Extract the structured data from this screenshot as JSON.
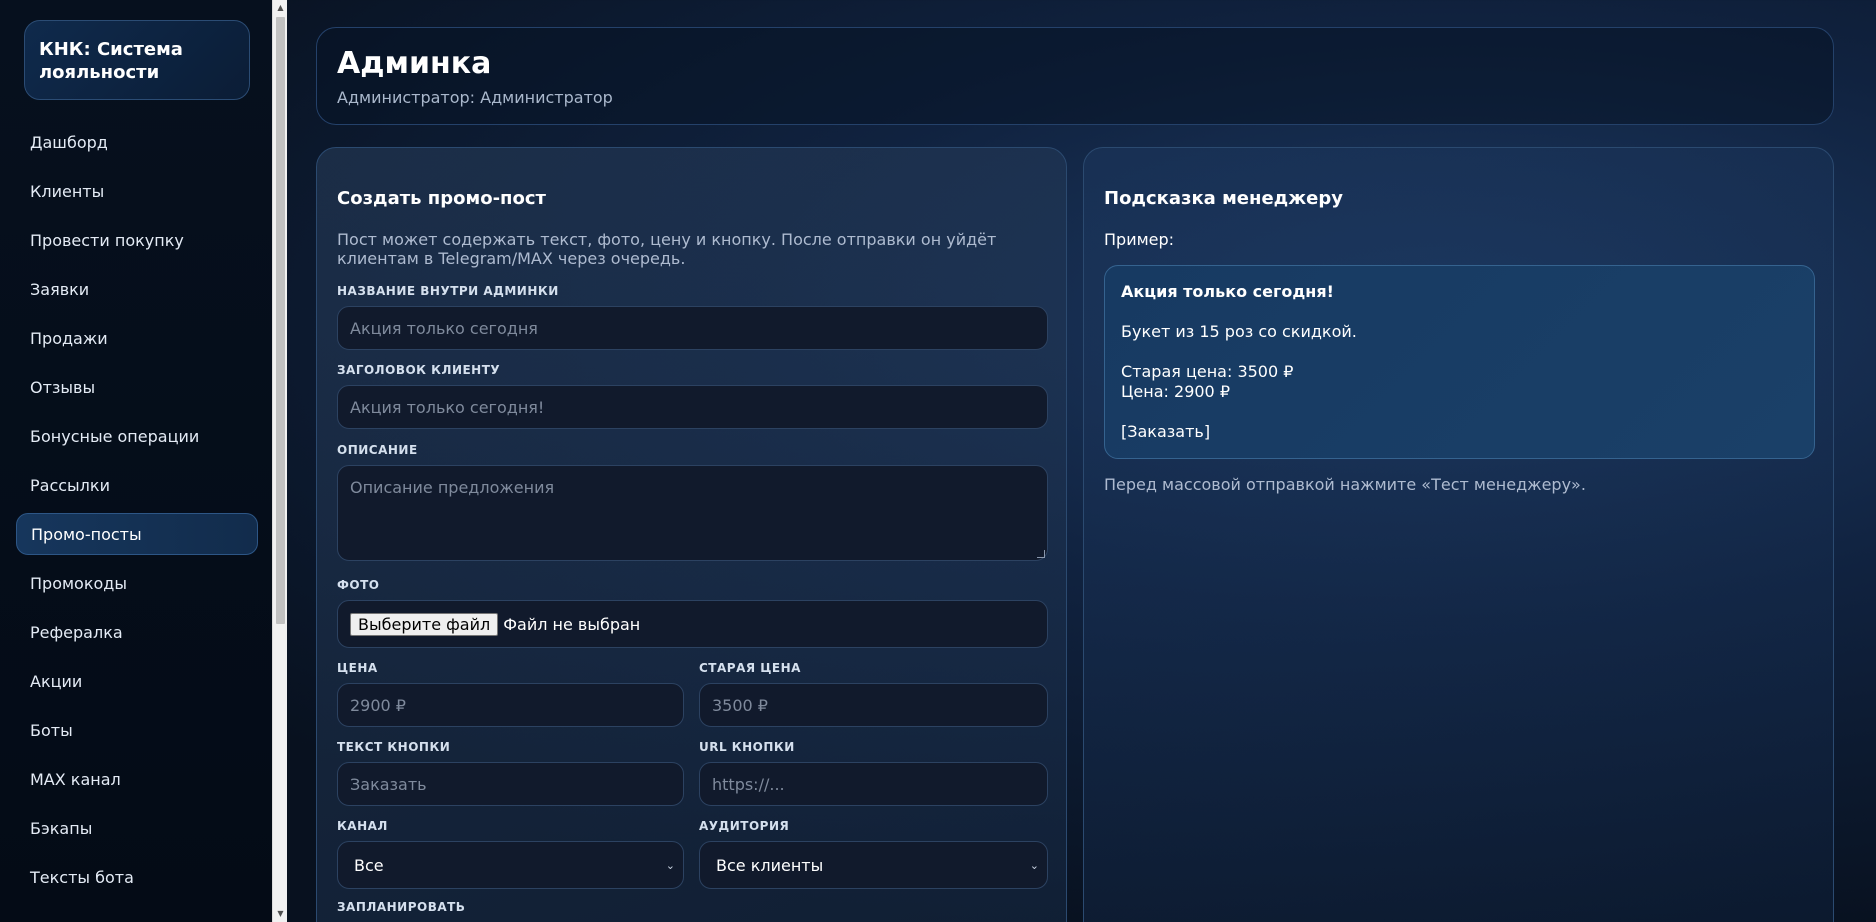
{
  "brand": {
    "title": "КНК: Система лояльности"
  },
  "nav": [
    {
      "label": "Дашборд"
    },
    {
      "label": "Клиенты"
    },
    {
      "label": "Провести покупку"
    },
    {
      "label": "Заявки"
    },
    {
      "label": "Продажи"
    },
    {
      "label": "Отзывы"
    },
    {
      "label": "Бонусные операции"
    },
    {
      "label": "Рассылки"
    },
    {
      "label": "Промо-посты",
      "active": true
    },
    {
      "label": "Промокоды"
    },
    {
      "label": "Рефералка"
    },
    {
      "label": "Акции"
    },
    {
      "label": "Боты"
    },
    {
      "label": "MAX канал"
    },
    {
      "label": "Бэкапы"
    },
    {
      "label": "Тексты бота"
    }
  ],
  "header": {
    "title": "Админка",
    "subtitle": "Администратор: Администратор"
  },
  "form": {
    "title": "Создать промо-пост",
    "description": "Пост может содержать текст, фото, цену и кнопку. После отправки он уйдёт клиентам в Telegram/MAX через очередь.",
    "internal_name_label": "НАЗВАНИЕ ВНУТРИ АДМИНКИ",
    "internal_name_placeholder": "Акция только сегодня",
    "client_title_label": "ЗАГОЛОВОК КЛИЕНТУ",
    "client_title_placeholder": "Акция только сегодня!",
    "description_label": "ОПИСАНИЕ",
    "description_placeholder": "Описание предложения",
    "photo_label": "ФОТО",
    "photo_button": "Выберите файл",
    "photo_status": "Файл не выбран",
    "price_label": "ЦЕНА",
    "price_placeholder": "2900 ₽",
    "old_price_label": "СТАРАЯ ЦЕНА",
    "old_price_placeholder": "3500 ₽",
    "button_text_label": "ТЕКСТ КНОПКИ",
    "button_text_placeholder": "Заказать",
    "button_url_label": "URL КНОПКИ",
    "button_url_placeholder": "https://...",
    "channel_label": "КАНАЛ",
    "channel_value": "Все",
    "audience_label": "АУДИТОРИЯ",
    "audience_value": "Все клиенты",
    "schedule_label": "ЗАПЛАНИРОВАТЬ"
  },
  "hint": {
    "title": "Подсказка менеджеру",
    "example_label": "Пример:",
    "preview": {
      "headline": "Акция только сегодня!",
      "body": "Букет из 15 роз со скидкой.",
      "old_price": "Старая цена: 3500 ₽",
      "price": "Цена: 2900 ₽",
      "button": "[Заказать]"
    },
    "note": "Перед массовой отправкой нажмите «Тест менеджеру»."
  },
  "colors": {
    "accent": "#16365c",
    "background": "#08111f",
    "card_border": "#2b4a70"
  }
}
